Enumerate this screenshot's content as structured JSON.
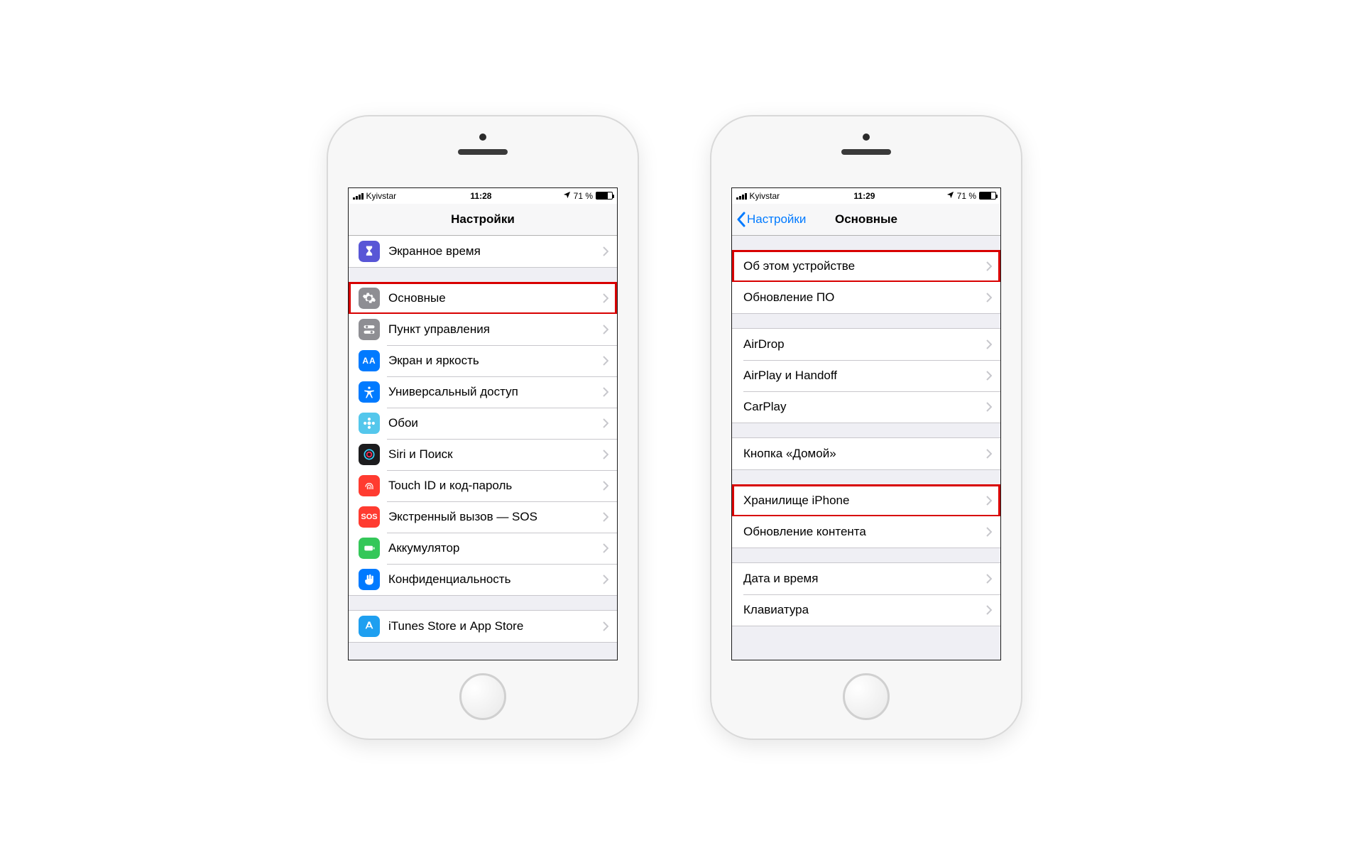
{
  "statusbar": {
    "carrier": "Kyivstar",
    "time_left": "11:28",
    "time_right": "11:29",
    "battery_text": "71 %"
  },
  "left": {
    "title": "Настройки",
    "rows": {
      "screentime": "Экранное время",
      "general": "Основные",
      "control_center": "Пункт управления",
      "display": "Экран и яркость",
      "accessibility": "Универсальный доступ",
      "wallpaper": "Обои",
      "siri": "Siri и Поиск",
      "touchid": "Touch ID и код-пароль",
      "sos": "Экстренный вызов — SOS",
      "battery": "Аккумулятор",
      "privacy": "Конфиденциальность",
      "appstore": "iTunes Store и App Store"
    },
    "icon_text": {
      "display": "AA",
      "sos": "SOS"
    }
  },
  "right": {
    "back_label": "Настройки",
    "title": "Основные",
    "rows": {
      "about": "Об этом устройстве",
      "software_update": "Обновление ПО",
      "airdrop": "AirDrop",
      "airplay": "AirPlay и Handoff",
      "carplay": "CarPlay",
      "home_button": "Кнопка «Домой»",
      "storage": "Хранилище iPhone",
      "background_refresh": "Обновление контента",
      "date_time": "Дата и время",
      "keyboard": "Клавиатура"
    }
  }
}
